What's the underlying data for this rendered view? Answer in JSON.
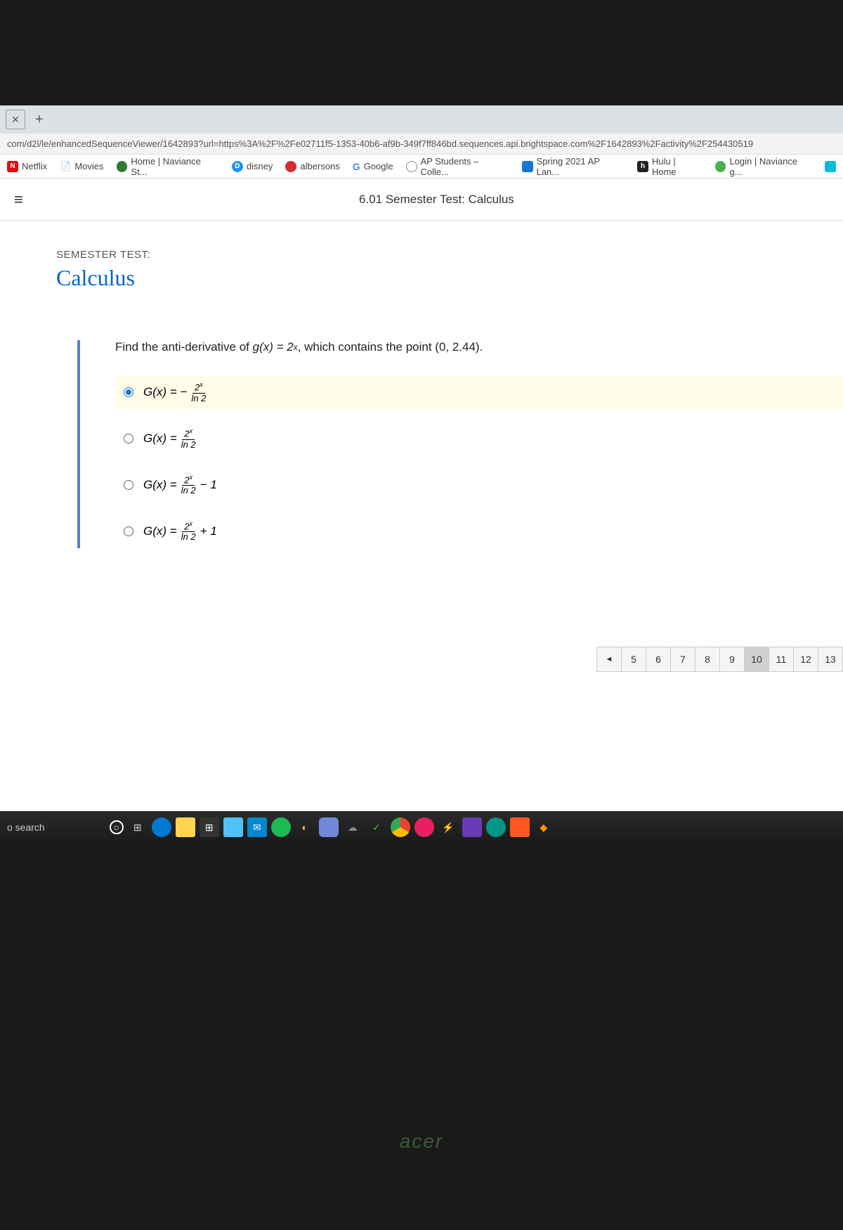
{
  "url": "com/d2l/le/enhancedSequenceViewer/1642893?url=https%3A%2F%2Fe02711f5-1353-40b6-af9b-349f7ff846bd.sequences.api.brightspace.com%2F1642893%2Factivity%2F254430519",
  "bookmarks": {
    "netflix": "Netflix",
    "movies": "Movies",
    "naviance": "Home | Naviance St...",
    "disney": "disney",
    "albersons": "albersons",
    "google": "Google",
    "ap": "AP Students – Colle...",
    "spring": "Spring 2021 AP Lan...",
    "hulu": "Hulu | Home",
    "naviance2": "Login | Naviance g..."
  },
  "page_title": "6.01 Semester Test: Calculus",
  "test_label": "SEMESTER TEST:",
  "test_name": "Calculus",
  "question": {
    "prefix": "Find the anti-derivative of ",
    "gx": "g(x) = 2",
    "gx_exp": "x",
    "suffix": ", which contains the point (0, 2.44)."
  },
  "options": {
    "a": {
      "lhs": "G(x) = −",
      "num": "2",
      "numexp": "x",
      "den": "ln 2",
      "tail": ""
    },
    "b": {
      "lhs": "G(x) = ",
      "num": "2",
      "numexp": "x",
      "den": "ln 2",
      "tail": ""
    },
    "c": {
      "lhs": "G(x) = ",
      "num": "2",
      "numexp": "x",
      "den": "ln 2",
      "tail": " − 1"
    },
    "d": {
      "lhs": "G(x) = ",
      "num": "2",
      "numexp": "x",
      "den": "ln 2",
      "tail": " + 1"
    }
  },
  "pagination": [
    "◄",
    "5",
    "6",
    "7",
    "8",
    "9",
    "10",
    "11",
    "12",
    "13"
  ],
  "taskbar_search": "o search",
  "laptop_brand": "acer"
}
